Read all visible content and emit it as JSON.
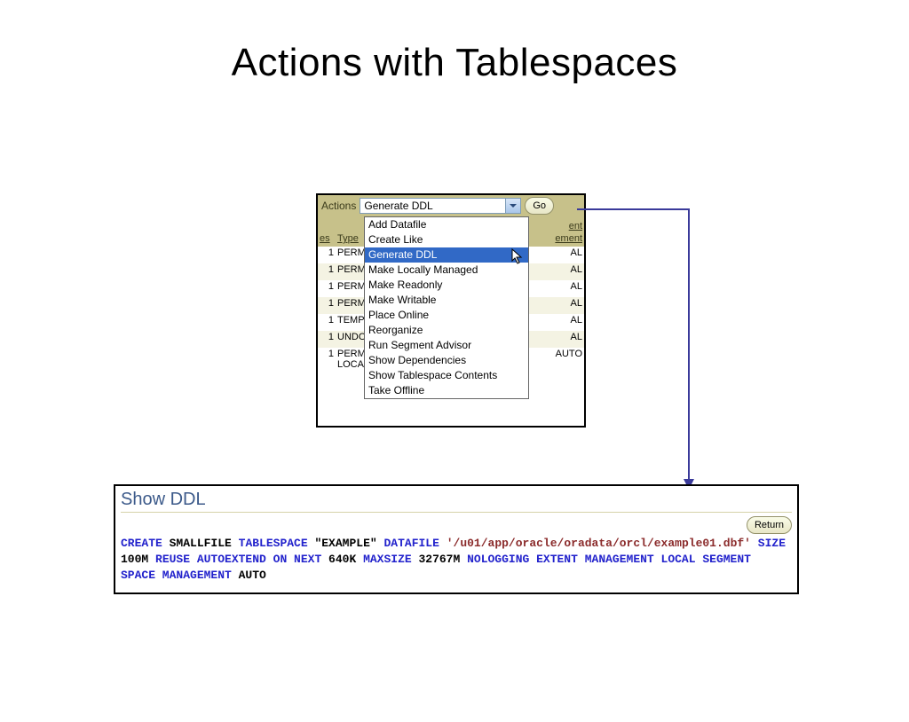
{
  "title": "Actions with Tablespaces",
  "actions": {
    "label": "Actions",
    "selected": "Generate DDL",
    "go": "Go",
    "options": [
      "Add Datafile",
      "Create Like",
      "Generate DDL",
      "Make Locally Managed",
      "Make Readonly",
      "Make Writable",
      "Place Online",
      "Reorganize",
      "Run Segment Advisor",
      "Show Dependencies",
      "Show Tablespace Contents",
      "Take Offline"
    ],
    "selected_index": 2
  },
  "grid": {
    "headers": {
      "es": "es",
      "type": "Type",
      "mgmt_line1": "ent",
      "mgmt_line2": "ement"
    },
    "rows": [
      {
        "es": "1",
        "type": "PERM",
        "mgmt": "AL"
      },
      {
        "es": "1",
        "type": "PERM",
        "mgmt": "AL"
      },
      {
        "es": "1",
        "type": "PERM",
        "mgmt": "AL"
      },
      {
        "es": "1",
        "type": "PERM",
        "mgmt": "AL"
      },
      {
        "es": "1",
        "type": "TEMP",
        "mgmt": "AL"
      },
      {
        "es": "1",
        "type": "UNDO",
        "mgmt": "AL"
      },
      {
        "es": "1",
        "type": "PERMANENT LOCAL",
        "mgmt": "AUTO"
      }
    ]
  },
  "ddl_panel": {
    "title": "Show DDL",
    "return": "Return",
    "tokens": [
      {
        "t": "CREATE",
        "c": "kw"
      },
      {
        "t": " SMALLFILE ",
        "c": "plain"
      },
      {
        "t": "TABLESPACE",
        "c": "kw"
      },
      {
        "t": " \"EXAMPLE\" ",
        "c": "plain"
      },
      {
        "t": "DATAFILE",
        "c": "kw"
      },
      {
        "t": " ",
        "c": "plain"
      },
      {
        "t": "'/u01/app/oracle/oradata/orcl/example01.dbf'",
        "c": "str"
      },
      {
        "t": " ",
        "c": "plain"
      },
      {
        "t": "SIZE",
        "c": "kw"
      },
      {
        "t": " 100M ",
        "c": "plain"
      },
      {
        "t": "REUSE AUTOEXTEND ON NEXT",
        "c": "kw"
      },
      {
        "t": " 640K ",
        "c": "plain"
      },
      {
        "t": "MAXSIZE",
        "c": "kw"
      },
      {
        "t": " 32767M ",
        "c": "plain"
      },
      {
        "t": "NOLOGGING EXTENT MANAGEMENT LOCAL SEGMENT SPACE MANAGEMENT",
        "c": "kw"
      },
      {
        "t": " AUTO",
        "c": "plain"
      }
    ]
  },
  "colors": {
    "olive": "#c7c18a",
    "keyword": "#2222cc",
    "string": "#8b2b2b",
    "connector": "#3a3a9a",
    "highlight": "#3169c6"
  }
}
